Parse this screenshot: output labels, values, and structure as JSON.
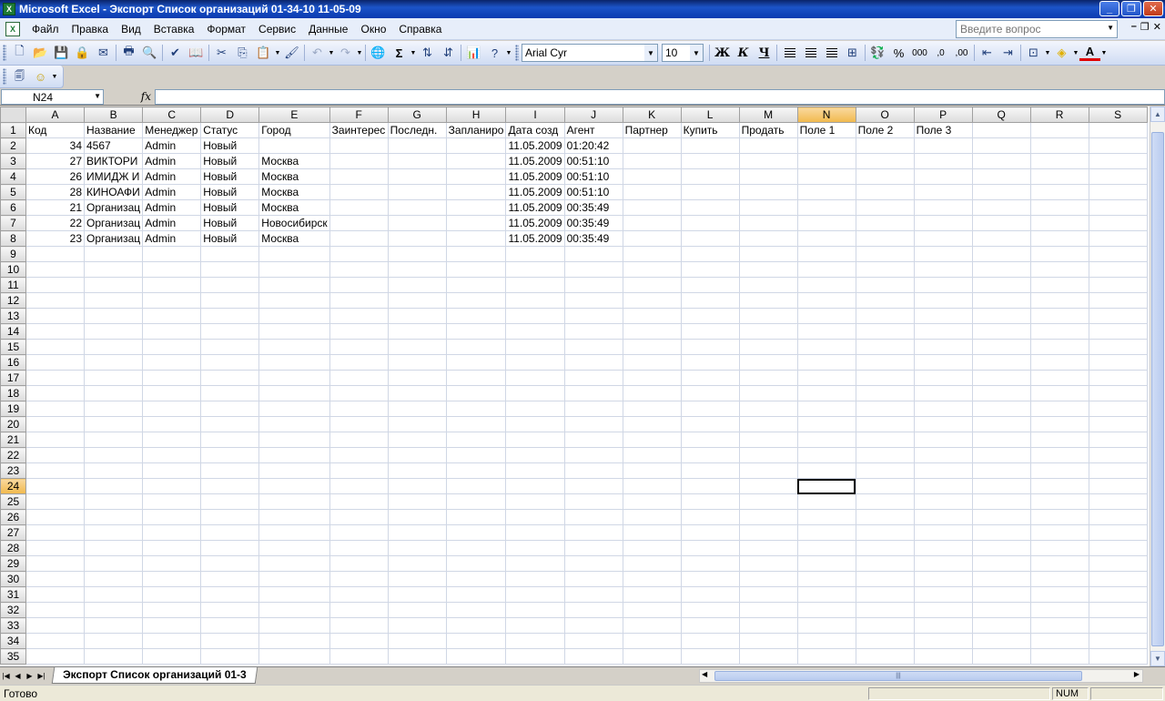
{
  "window": {
    "title": "Microsoft Excel - Экспорт Список организаций 01-34-10 11-05-09",
    "app_icon": "excel-icon"
  },
  "menu": {
    "items": [
      "Файл",
      "Правка",
      "Вид",
      "Вставка",
      "Формат",
      "Сервис",
      "Данные",
      "Окно",
      "Справка"
    ],
    "help_placeholder": "Введите вопрос"
  },
  "toolbar": {
    "font_name": "Arial Cyr",
    "font_size": "10",
    "bold_label": "Ж",
    "italic_label": "К",
    "underline_label": "Ч",
    "sum_label": "Σ",
    "percent_label": "%",
    "thousands_label": "000",
    "inc_decimal_label": ",0",
    "dec_decimal_label": ",00"
  },
  "formula_bar": {
    "cell_ref": "N24",
    "fx_label": "fx",
    "formula": ""
  },
  "sheet": {
    "columns": [
      "A",
      "B",
      "C",
      "D",
      "E",
      "F",
      "G",
      "H",
      "I",
      "J",
      "K",
      "L",
      "M",
      "N",
      "O",
      "P",
      "Q",
      "R",
      "S"
    ],
    "active_column": "N",
    "active_row": 24,
    "row_count": 35,
    "rows": [
      [
        "Код",
        "Название",
        "Менеджер",
        "Статус",
        "Город",
        "Заинтерес",
        "Последн.",
        "Запланиро",
        "Дата созд",
        "Агент",
        "Партнер",
        "Купить",
        "Продать",
        "Поле 1",
        "Поле 2",
        "Поле 3",
        "",
        "",
        ""
      ],
      [
        "34",
        "4567",
        "Admin",
        "Новый",
        "",
        "",
        "",
        "",
        "11.05.2009",
        "01:20:42",
        "",
        "",
        "",
        "",
        "",
        "",
        "",
        "",
        ""
      ],
      [
        "27",
        "ВИКТОРИ",
        "Admin",
        "Новый",
        "Москва",
        "",
        "",
        "",
        "11.05.2009",
        "00:51:10",
        "",
        "",
        "",
        "",
        "",
        "",
        "",
        "",
        ""
      ],
      [
        "26",
        "ИМИДЖ И",
        "Admin",
        "Новый",
        "Москва",
        "",
        "",
        "",
        "11.05.2009",
        "00:51:10",
        "",
        "",
        "",
        "",
        "",
        "",
        "",
        "",
        ""
      ],
      [
        "28",
        "КИНОАФИ",
        "Admin",
        "Новый",
        "Москва",
        "",
        "",
        "",
        "11.05.2009",
        "00:51:10",
        "",
        "",
        "",
        "",
        "",
        "",
        "",
        "",
        ""
      ],
      [
        "21",
        "Организац",
        "Admin",
        "Новый",
        "Москва",
        "",
        "",
        "",
        "11.05.2009",
        "00:35:49",
        "",
        "",
        "",
        "",
        "",
        "",
        "",
        "",
        ""
      ],
      [
        "22",
        "Организац",
        "Admin",
        "Новый",
        "Новосибирск",
        "",
        "",
        "",
        "11.05.2009",
        "00:35:49",
        "",
        "",
        "",
        "",
        "",
        "",
        "",
        "",
        ""
      ],
      [
        "23",
        "Организац",
        "Admin",
        "Новый",
        "Москва",
        "",
        "",
        "",
        "11.05.2009",
        "00:35:49",
        "",
        "",
        "",
        "",
        "",
        "",
        "",
        "",
        ""
      ]
    ],
    "numeric_columns": [
      0
    ]
  },
  "tabs": {
    "sheet_name": "Экспорт Список организаций 01-3"
  },
  "status": {
    "text": "Готово",
    "num_indicator": "NUM"
  }
}
